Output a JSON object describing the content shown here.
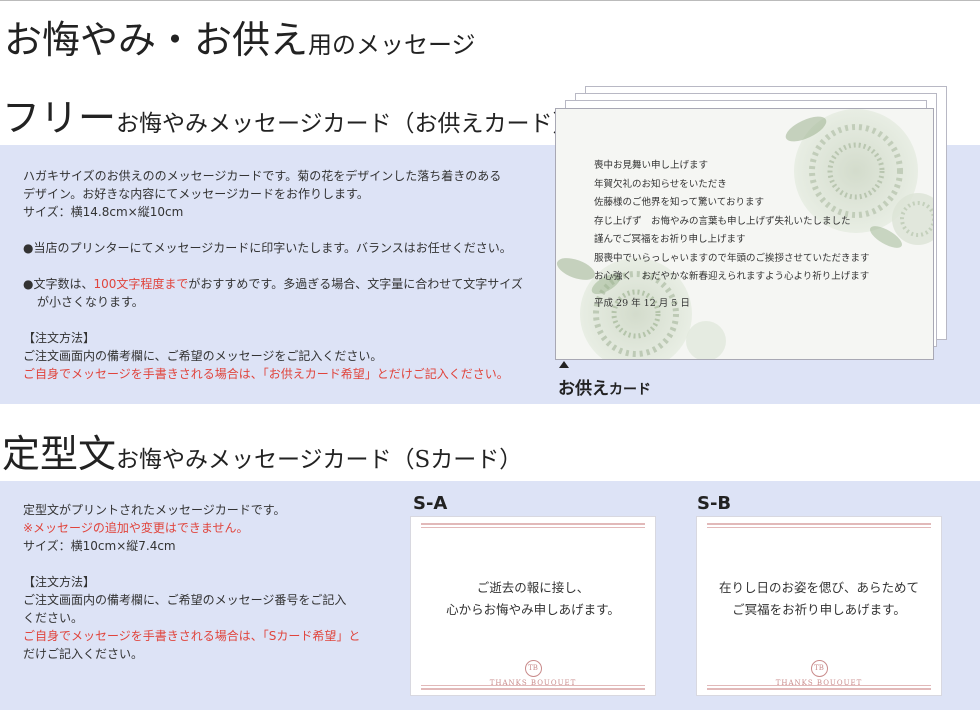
{
  "header": {
    "title_main": "お悔やみ・お供え",
    "title_suffix": "用のメッセージ"
  },
  "free_section": {
    "title_big": "フリー",
    "title_sub": "お悔やみメッセージカード（お供えカード）",
    "desc_line1": "ハガキサイズのお供えののメッセージカードです。菊の花をデザインした落ち着きのある",
    "desc_line2": "デザイン。お好きな内容にてメッセージカードをお作りします。",
    "size": "サイズ：横14.8cm×縦10cm",
    "note1": "●当店のプリンターにてメッセージカードに印字いたします。バランスはお任せください。",
    "note2_prefix": "●文字数は、",
    "note2_highlight": "100文字程度まで",
    "note2_suffix": "がおすすめです。多過ぎる場合、文字量に合わせて文字サイズ",
    "note2_line2": "が小さくなります。",
    "order_heading": "【注文方法】",
    "order_line1": "ご注文画面内の備考欄に、ご希望のメッセージをご記入ください。",
    "order_line2_red": "ご自身でメッセージを手書きされる場合は、「お供えカード希望」とだけご記入ください。",
    "card_lines": [
      "喪中お見舞い申し上げます",
      "年賀欠礼のお知らせをいただき",
      "佐藤様のご他界を知って驚いております",
      "存じ上げず　お悔やみの言葉も申し上げず失礼いたしました",
      "謹んでご冥福をお祈り申し上げます",
      "服喪中でいらっしゃいますので年頭のご挨拶させていただきます",
      "お心強く　おだやかな新春迎えられますよう心より祈り上げます"
    ],
    "card_date": "平成 29 年 12 月 5 日",
    "card_caption_big": "お供え",
    "card_caption_small": "カード"
  },
  "fixed_section": {
    "title_big": "定型文",
    "title_sub": "お悔やみメッセージカード（Sカード）",
    "desc_line1": "定型文がプリントされたメッセージカードです。",
    "desc_red": "※メッセージの追加や変更はできません。",
    "size": "サイズ：横10cm×縦7.4cm",
    "order_heading": "【注文方法】",
    "order_line1": "ご注文画面内の備考欄に、ご希望のメッセージ番号をご記入",
    "order_line2": "ください。",
    "order_red_prefix": "ご自身でメッセージを手書きされる場合は、「Sカード希望」と",
    "order_line3": "だけご記入ください。",
    "cards": [
      {
        "label": "S-A",
        "line1": "ご逝去の報に接し、",
        "line2": "心からお悔やみ申しあげます。",
        "logo_mark": "TB",
        "logo_text": "THANKS BOUQUET"
      },
      {
        "label": "S-B",
        "line1": "在りし日のお姿を偲び、あらためて",
        "line2": "ご冥福をお祈り申しあげます。",
        "logo_mark": "TB",
        "logo_text": "THANKS BOUQUET"
      }
    ]
  },
  "colors": {
    "band": "#dde3f6",
    "highlight_red": "#e0443c",
    "card_stripe": "#e2b9b9",
    "flower_green": "#9cb38f"
  }
}
